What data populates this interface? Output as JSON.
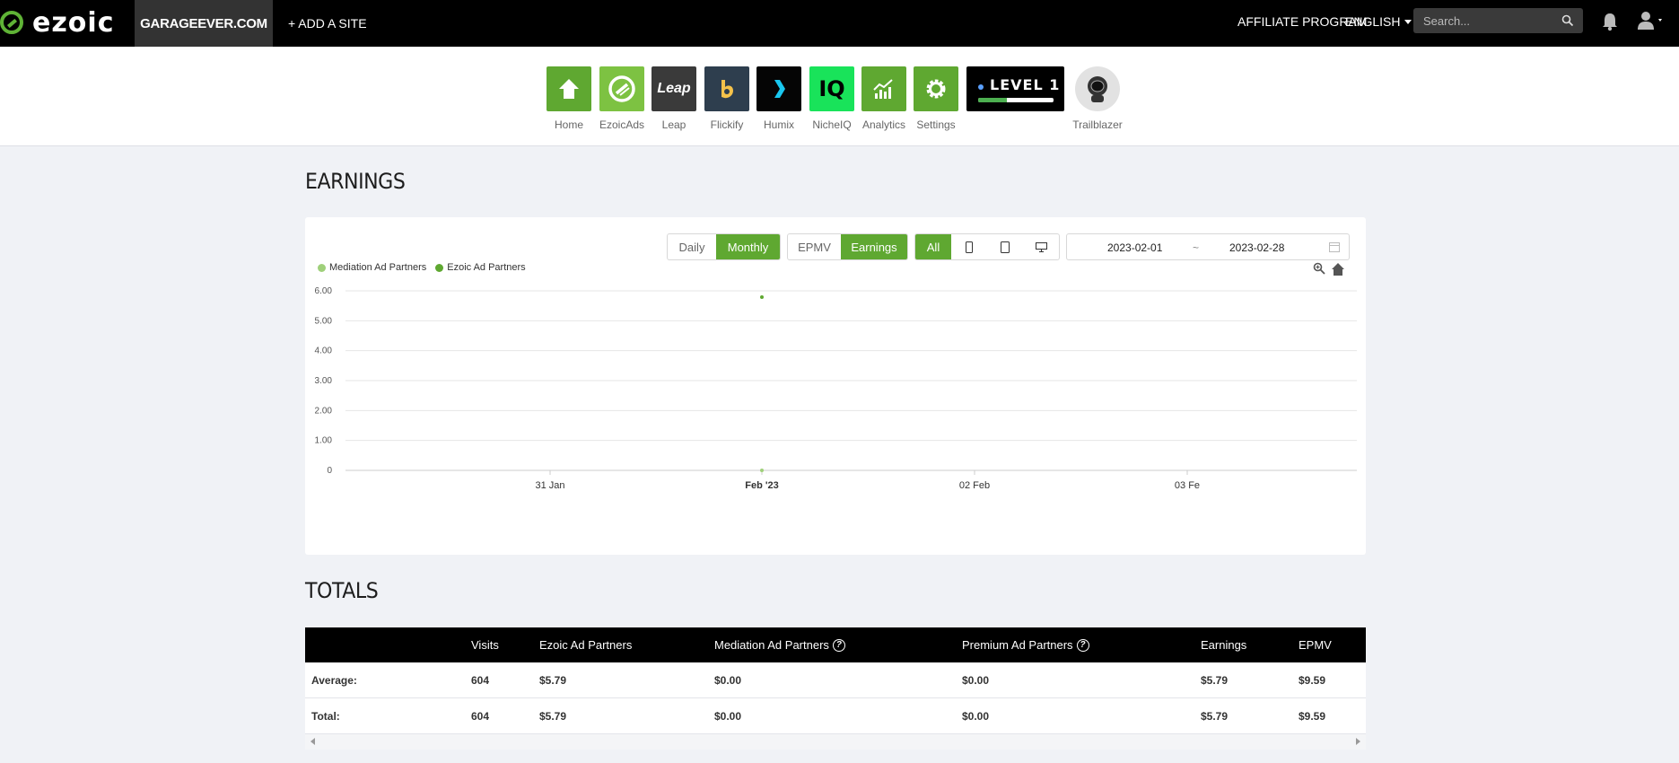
{
  "header": {
    "brand": "ezoic",
    "site": "GARAGEEVER.COM",
    "add_site": "+ ADD A SITE",
    "affiliate": "AFFILIATE PROGRAM",
    "language": "ENGLISH",
    "search_placeholder": "Search..."
  },
  "apps": [
    {
      "label": "Home",
      "icon": "home-icon",
      "color": "#5fa831"
    },
    {
      "label": "EzoicAds",
      "icon": "ezoicads-icon",
      "color": "#7dc242"
    },
    {
      "label": "Leap",
      "icon": "leap-icon",
      "color": "#3a3a3a",
      "text": "Leap"
    },
    {
      "label": "Flickify",
      "icon": "flickify-icon",
      "color": "#2e3e4e"
    },
    {
      "label": "Humix",
      "icon": "humix-icon",
      "color": "#050505"
    },
    {
      "label": "NicheIQ",
      "icon": "nicheiq-icon",
      "color": "#19e35a",
      "text": "IQ"
    },
    {
      "label": "Analytics",
      "icon": "analytics-icon",
      "color": "#5fa831"
    },
    {
      "label": "Settings",
      "icon": "gear-icon",
      "color": "#5fa831"
    }
  ],
  "level": {
    "text": "LEVEL 1",
    "progress": 0.38
  },
  "trailblazer": {
    "label": "Trailblazer"
  },
  "earnings": {
    "title": "EARNINGS"
  },
  "controls": {
    "period": [
      {
        "label": "Daily",
        "active": false
      },
      {
        "label": "Monthly",
        "active": true
      }
    ],
    "metric": [
      {
        "label": "EPMV",
        "active": false
      },
      {
        "label": "Earnings",
        "active": true
      }
    ],
    "device": [
      {
        "label": "All",
        "active": true
      },
      {
        "icon": "mobile-icon"
      },
      {
        "icon": "tablet-icon"
      },
      {
        "icon": "desktop-icon"
      }
    ],
    "date_start": "2023-02-01",
    "date_sep": "~",
    "date_end": "2023-02-28"
  },
  "chart_data": {
    "type": "scatter",
    "series": [
      {
        "name": "Mediation Ad Partners",
        "color": "#9fd07a",
        "points": [
          {
            "x": "Feb '23",
            "y": 0
          }
        ]
      },
      {
        "name": "Ezoic Ad Partners",
        "color": "#5fa831",
        "points": [
          {
            "x": "Feb '23",
            "y": 5.79
          }
        ]
      }
    ],
    "x_ticks": [
      "31 Jan",
      "Feb '23",
      "02 Feb",
      "03 Fe"
    ],
    "y_ticks": [
      "0",
      "1.00",
      "2.00",
      "3.00",
      "4.00",
      "5.00",
      "6.00"
    ],
    "ylim": [
      0,
      6
    ],
    "grid": true,
    "legend": "top-left"
  },
  "totals": {
    "title": "TOTALS",
    "columns": [
      "",
      "Visits",
      "Ezoic Ad Partners",
      "Mediation Ad Partners",
      "Premium Ad Partners",
      "Earnings",
      "EPMV"
    ],
    "rows": [
      [
        "Average:",
        "604",
        "$5.79",
        "$0.00",
        "$0.00",
        "$5.79",
        "$9.59"
      ],
      [
        "Total:",
        "604",
        "$5.79",
        "$0.00",
        "$0.00",
        "$5.79",
        "$9.59"
      ]
    ]
  }
}
